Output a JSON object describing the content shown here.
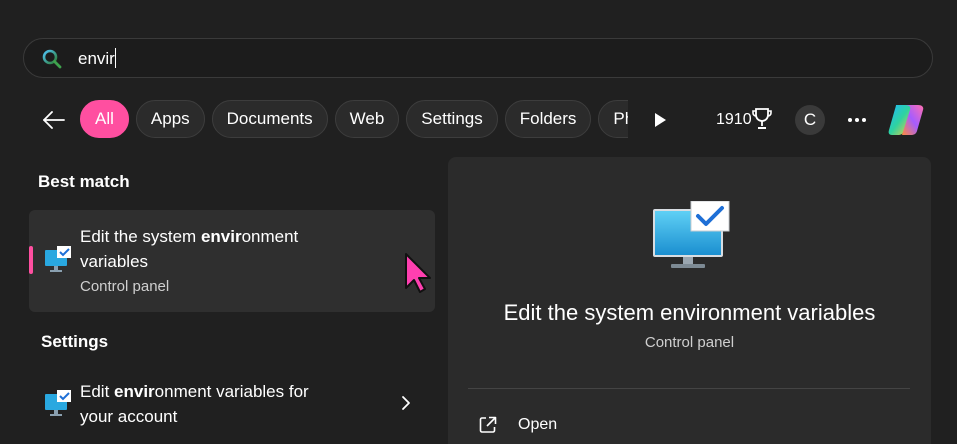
{
  "search": {
    "value": "envir",
    "placeholder": ""
  },
  "filters": {
    "back_label": "Back",
    "chips": [
      "All",
      "Apps",
      "Documents",
      "Web",
      "Settings",
      "Folders",
      "Ph"
    ],
    "active": "All"
  },
  "header_right": {
    "points": "1910",
    "avatar_initial": "C"
  },
  "best_match": {
    "section_label": "Best match",
    "title_pre": "Edit the system ",
    "title_bold": "envir",
    "title_post": "onment",
    "title_line2": "variables",
    "subtitle": "Control panel"
  },
  "settings": {
    "section_label": "Settings",
    "title_pre": "Edit ",
    "title_bold": "envir",
    "title_post": "onment variables for",
    "title_line2": "your account"
  },
  "preview": {
    "title": "Edit the system environment variables",
    "subtitle": "Control panel",
    "open_label": "Open"
  },
  "colors": {
    "accent": "#ff4fa0",
    "background": "#202020",
    "panel": "#2b2b2b"
  },
  "icons": [
    "search-icon",
    "back-arrow-icon",
    "play-icon",
    "trophy-icon",
    "more-icon",
    "copilot-icon",
    "control-panel-icon",
    "chevron-right-icon",
    "open-external-icon",
    "mouse-cursor-icon"
  ]
}
